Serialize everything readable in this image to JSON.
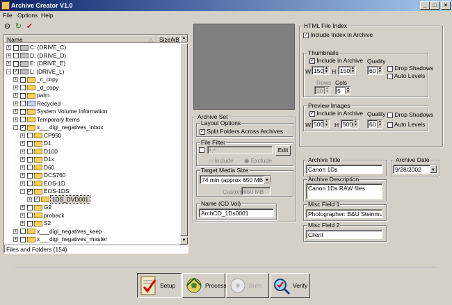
{
  "window": {
    "title": "Archive Creator V1.0",
    "min": "_",
    "max": "□",
    "close": "×"
  },
  "menu": [
    "File",
    "Options",
    "Help"
  ],
  "tree": {
    "col_name": "Name",
    "col_size": "Size/kB",
    "rows": [
      {
        "indent": 0,
        "pm": "+",
        "check": false,
        "icon": "drive",
        "label": "C: (DRIVE_C)"
      },
      {
        "indent": 0,
        "pm": "+",
        "check": false,
        "icon": "drive",
        "label": "D: (DRIVE_D)"
      },
      {
        "indent": 0,
        "pm": "+",
        "check": false,
        "icon": "drive",
        "label": "E: (DRIVE_E)"
      },
      {
        "indent": 0,
        "pm": "-",
        "check": true,
        "icon": "drive",
        "label": "L: (DRIVE_L)"
      },
      {
        "indent": 1,
        "pm": "+",
        "check": false,
        "icon": "folder",
        "label": "_c_copy"
      },
      {
        "indent": 1,
        "pm": "+",
        "check": false,
        "icon": "folder",
        "label": "_d_copy"
      },
      {
        "indent": 1,
        "pm": "+",
        "check": false,
        "icon": "folder",
        "label": "palm"
      },
      {
        "indent": 1,
        "pm": "+",
        "check": false,
        "icon": "recycle",
        "label": "Recycled"
      },
      {
        "indent": 1,
        "pm": "+",
        "check": false,
        "icon": "folder",
        "label": "System Volume Information"
      },
      {
        "indent": 1,
        "pm": "+",
        "check": false,
        "icon": "folder",
        "label": "Temporary Items"
      },
      {
        "indent": 1,
        "pm": "-",
        "check": true,
        "icon": "folder",
        "label": "x___digi_negatives_inbox"
      },
      {
        "indent": 2,
        "pm": "+",
        "check": false,
        "icon": "folder",
        "label": "CP950"
      },
      {
        "indent": 2,
        "pm": "+",
        "check": false,
        "icon": "folder",
        "label": "D1"
      },
      {
        "indent": 2,
        "pm": "+",
        "check": false,
        "icon": "folder",
        "label": "D100"
      },
      {
        "indent": 2,
        "pm": "+",
        "check": false,
        "icon": "folder",
        "label": "D1x"
      },
      {
        "indent": 2,
        "pm": "+",
        "check": false,
        "icon": "folder",
        "label": "D60"
      },
      {
        "indent": 2,
        "pm": "+",
        "check": false,
        "icon": "folder",
        "label": "DCS760"
      },
      {
        "indent": 2,
        "pm": "+",
        "check": false,
        "icon": "folder",
        "label": "EOS-1D"
      },
      {
        "indent": 2,
        "pm": "-",
        "check": true,
        "icon": "folder",
        "label": "EOS-1DS"
      },
      {
        "indent": 3,
        "pm": "+",
        "check": true,
        "icon": "folder",
        "label": "1DS_DVD001",
        "selected": true
      },
      {
        "indent": 2,
        "pm": "+",
        "check": false,
        "icon": "folder",
        "label": "G2"
      },
      {
        "indent": 2,
        "pm": "+",
        "check": false,
        "icon": "folder",
        "label": "proback"
      },
      {
        "indent": 2,
        "pm": "+",
        "check": false,
        "icon": "folder",
        "label": "S2"
      },
      {
        "indent": 1,
        "pm": "+",
        "check": false,
        "icon": "folder",
        "label": "x___digi_negatives_keep"
      },
      {
        "indent": 1,
        "pm": "+",
        "check": false,
        "icon": "folder",
        "label": "x___digi_negatives_master"
      }
    ],
    "status": "Files and Folders (154)"
  },
  "archive_set": {
    "title": "Archive Set",
    "layout_title": "Layout Options",
    "split_label": "Split Folders Across Archives",
    "file_filter_title": "File Filter",
    "filter_value": "*.*",
    "edit_label": "Edit",
    "include_label": "Include",
    "exclude_label": "Exclude",
    "media_title": "Target Media Size",
    "media_value": "74 min (approx 650 MB)",
    "custom_label": "Custom",
    "custom_value": "650 MB",
    "name_title": "Name (CD Vol)",
    "name_value": "ArchCD_1Ds0001"
  },
  "html_index": {
    "title": "HTML File Index",
    "include_label": "Include Index in Archive",
    "thumbs": {
      "title": "Thumbnails",
      "include_label": "Include in Archive",
      "quality_label": "Quality",
      "w_label": "W",
      "w": "150",
      "h_label": "H",
      "h": "150",
      "quality": "60",
      "drop_shadows": "Drop Shadows",
      "auto_levels": "Auto Levels",
      "rows_label": "Rows",
      "cols_label": "Cols",
      "rows": "10",
      "cols": "5"
    },
    "preview": {
      "title": "Preview Images",
      "include_label": "Include in Archive",
      "quality_label": "Quality",
      "w_label": "W",
      "w": "500",
      "h_label": "H",
      "h": "500",
      "quality": "60",
      "drop_shadows": "Drop Shadows",
      "auto_levels": "Auto Levels"
    }
  },
  "fields": {
    "archive_title_label": "Archive Title",
    "archive_title": "Canon 1Ds",
    "archive_date_label": "Archive Date",
    "archive_date": "9/28/2002",
    "desc_label": "Archive Description",
    "desc": "Canon 1Ds RAW files",
    "misc1_label": "Misc Field 1",
    "misc1": "Photographer: B&U Steinmueller",
    "misc2_label": "Misc Field 2",
    "misc2": "Client"
  },
  "nav": {
    "setup": "Setup",
    "process": "Process",
    "burn": "Burn",
    "verify": "Verify"
  }
}
